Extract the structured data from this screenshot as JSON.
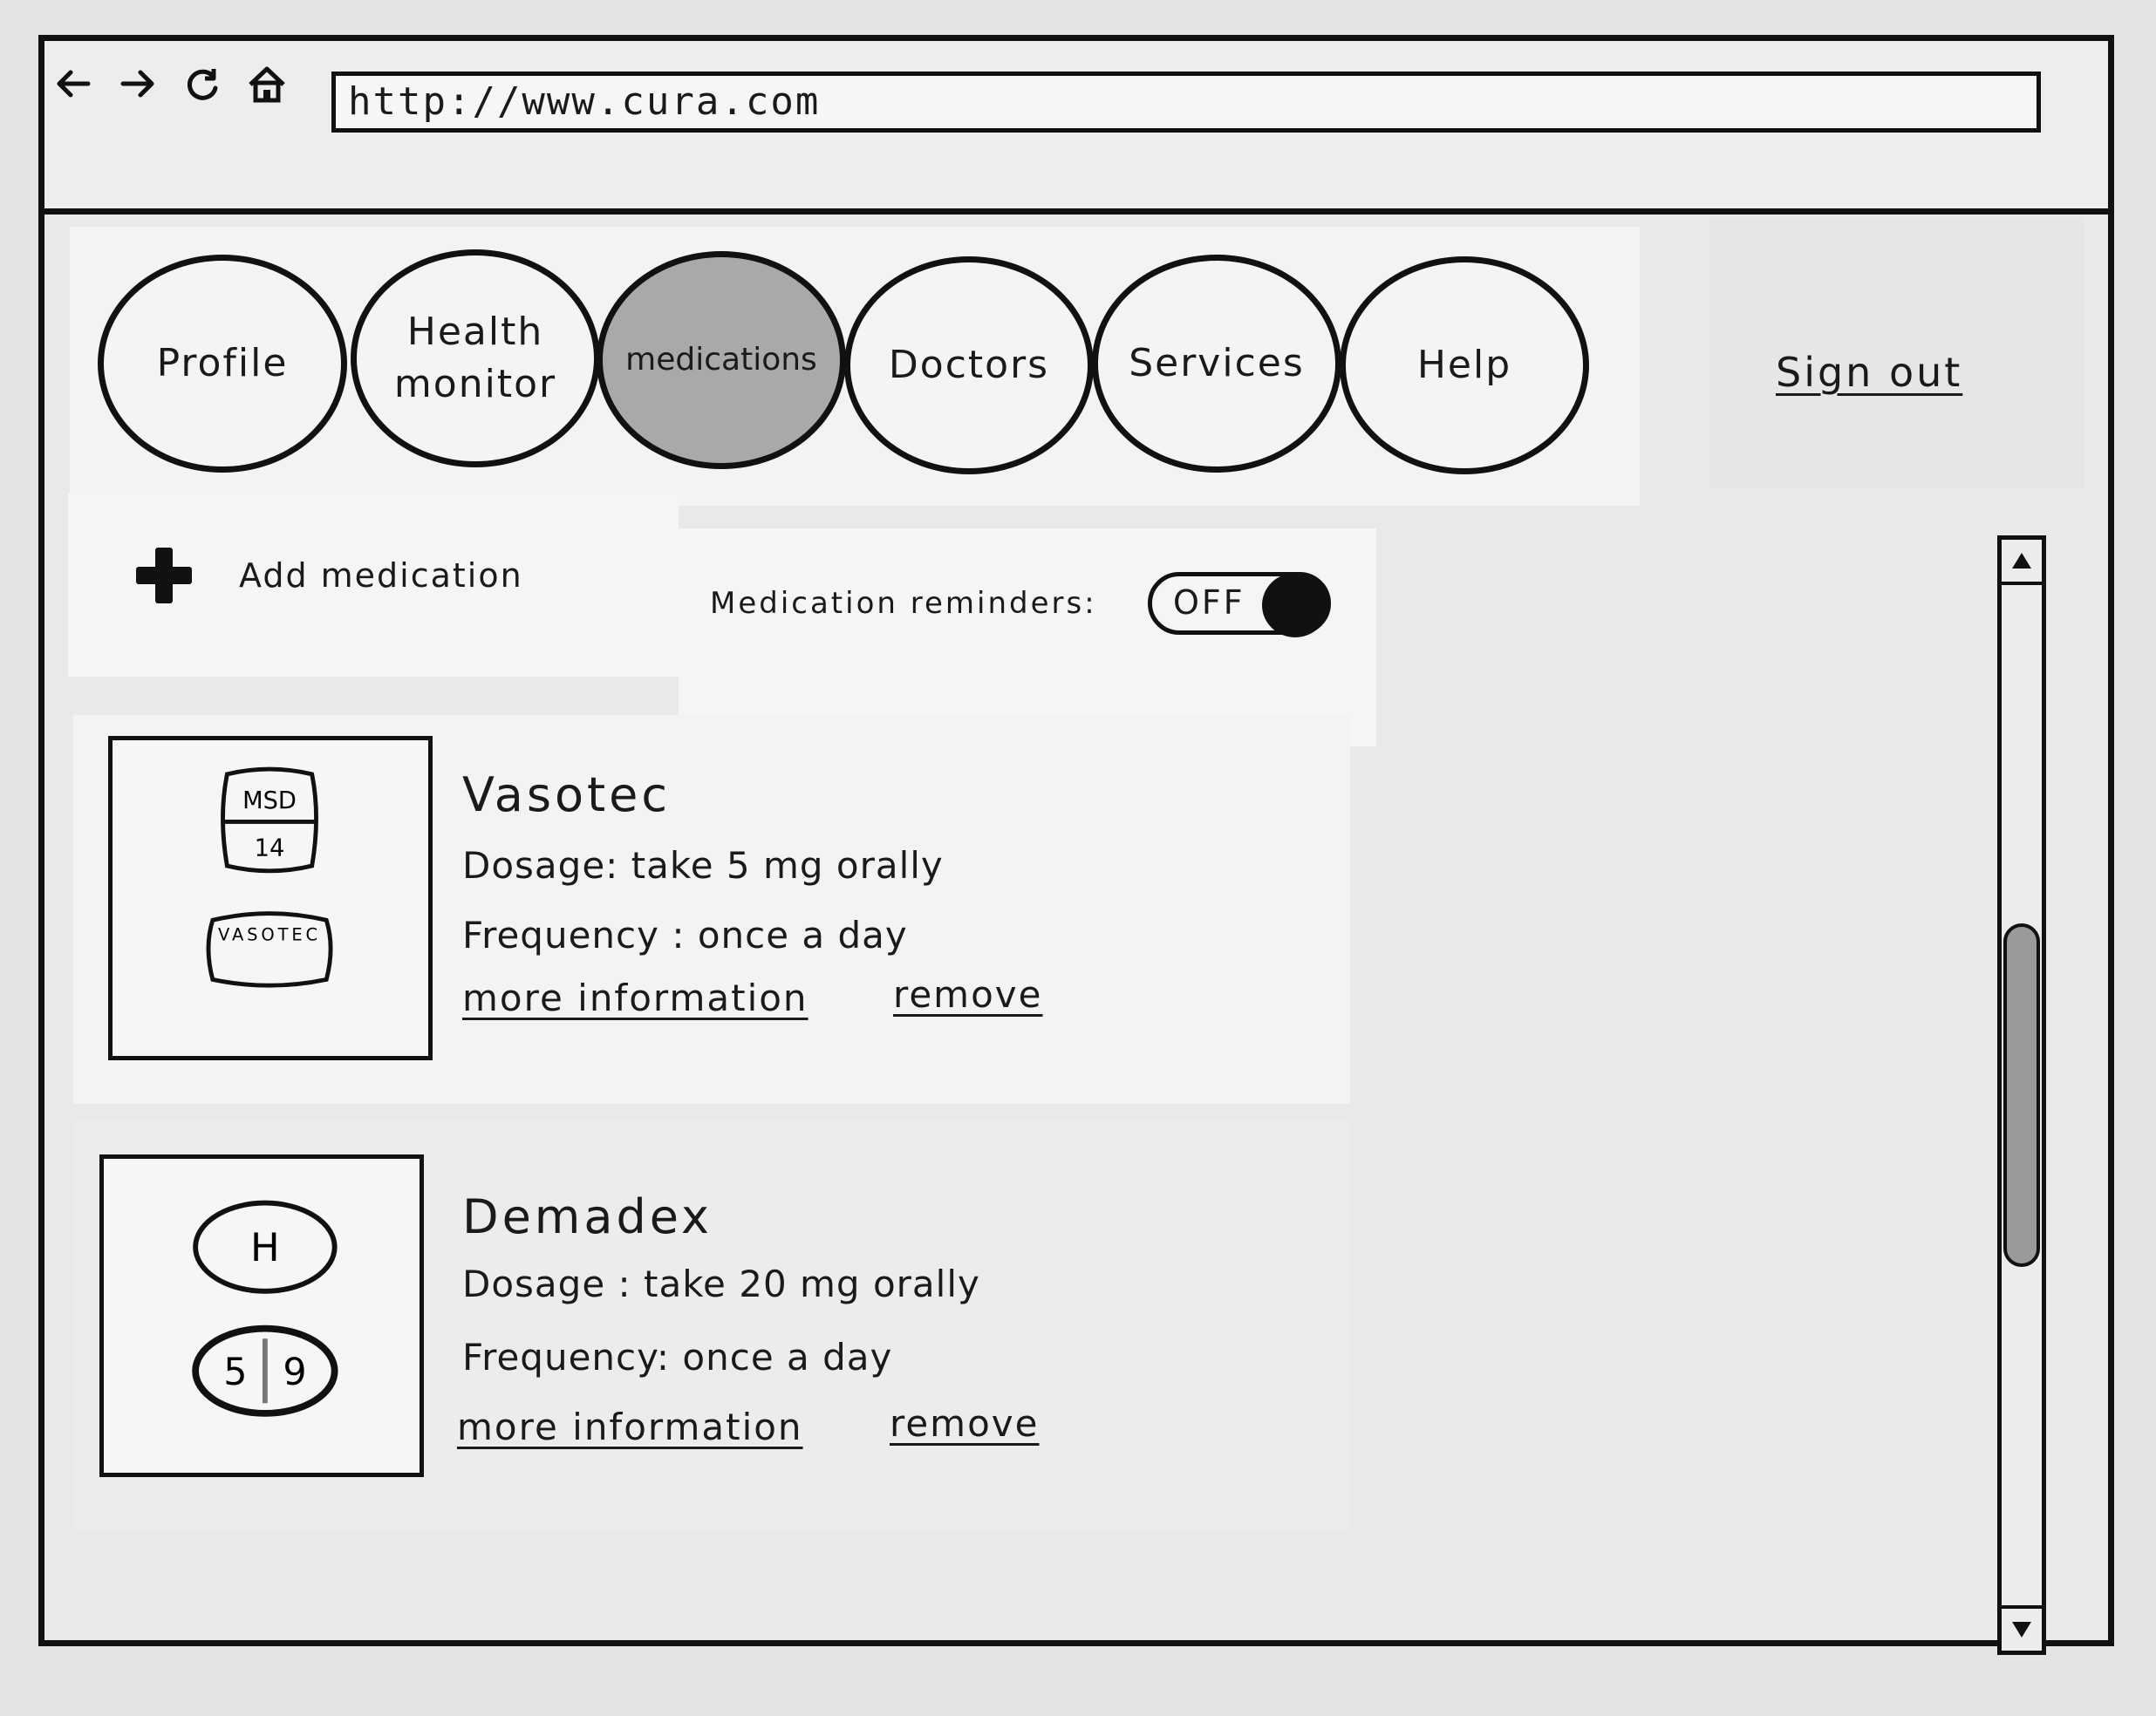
{
  "browser": {
    "url": "http://www.cura.com",
    "back_icon": "arrow-left-icon",
    "forward_icon": "arrow-right-icon",
    "reload_icon": "reload-icon",
    "home_icon": "home-icon"
  },
  "nav": {
    "tabs": [
      {
        "label_line1": "Profile",
        "label_line2": ""
      },
      {
        "label_line1": "Health",
        "label_line2": "monitor"
      },
      {
        "label_line1": "medications",
        "label_line2": "",
        "active": true
      },
      {
        "label_line1": "Doctors",
        "label_line2": ""
      },
      {
        "label_line1": "Services",
        "label_line2": ""
      },
      {
        "label_line1": "Help",
        "label_line2": ""
      }
    ],
    "signout": "Sign out"
  },
  "toolbar": {
    "add_label": "Add medication",
    "add_icon": "plus-icon",
    "reminders_label": "Medication reminders:",
    "reminders_state": "OFF"
  },
  "medications": [
    {
      "name": "Vasotec",
      "dosage": "Dosage: take 5 mg orally",
      "frequency": "Frequency : once a day",
      "more": "more information",
      "remove": "remove",
      "pill_top_a": "MSD",
      "pill_top_b": "14",
      "pill_bottom": "VASOTEC"
    },
    {
      "name": "Demadex",
      "dosage": "Dosage : take 20 mg orally",
      "frequency": "Frequency: once a day",
      "more": "more information",
      "remove": "remove",
      "pill_top": "H",
      "pill_bottom_a": "5",
      "pill_bottom_b": "9"
    }
  ]
}
